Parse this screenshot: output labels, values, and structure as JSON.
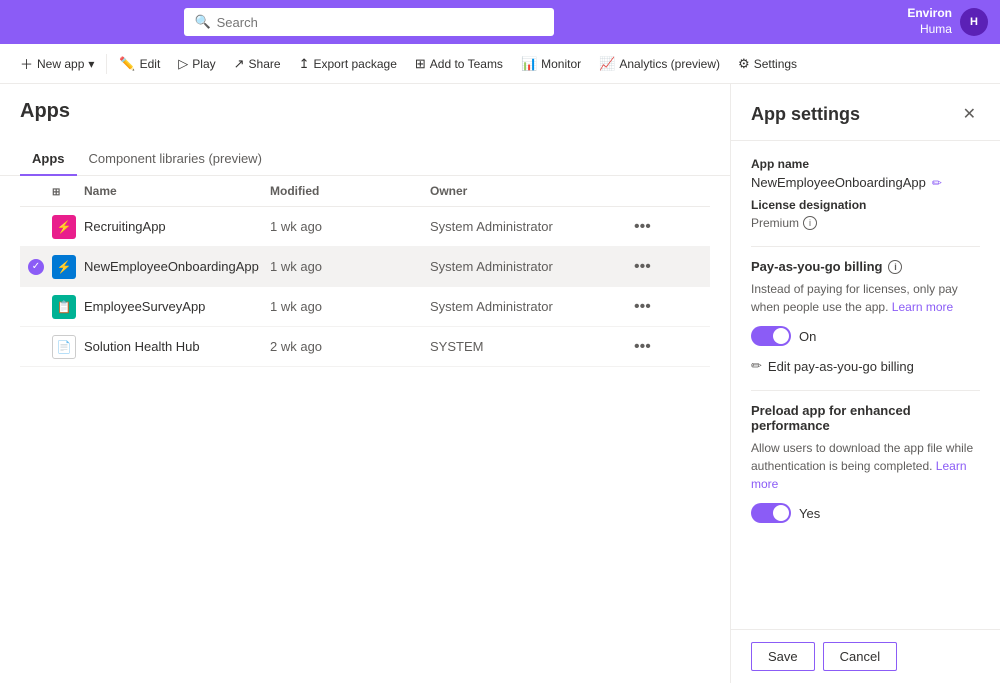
{
  "topbar": {
    "search_placeholder": "Search",
    "env_name": "Environ",
    "user_name": "Huma",
    "avatar_initials": "H"
  },
  "toolbar": {
    "new_app": "New app",
    "edit": "Edit",
    "play": "Play",
    "share": "Share",
    "export_package": "Export package",
    "add_to_teams": "Add to Teams",
    "monitor": "Monitor",
    "analytics": "Analytics (preview)",
    "settings": "Settings"
  },
  "page": {
    "title": "Apps",
    "tabs": [
      {
        "label": "Apps",
        "active": true
      },
      {
        "label": "Component libraries (preview)",
        "active": false
      }
    ]
  },
  "table": {
    "headers": [
      "",
      "",
      "Name",
      "Modified",
      "Owner",
      ""
    ],
    "rows": [
      {
        "id": 1,
        "name": "RecruitingApp",
        "modified": "1 wk ago",
        "owner": "System Administrator",
        "icon_type": "pink",
        "selected": false
      },
      {
        "id": 2,
        "name": "NewEmployeeOnboardingApp",
        "modified": "1 wk ago",
        "owner": "System Administrator",
        "icon_type": "blue",
        "selected": true
      },
      {
        "id": 3,
        "name": "EmployeeSurveyApp",
        "modified": "1 wk ago",
        "owner": "System Administrator",
        "icon_type": "teal",
        "selected": false
      },
      {
        "id": 4,
        "name": "Solution Health Hub",
        "modified": "2 wk ago",
        "owner": "SYSTEM",
        "icon_type": "doc",
        "selected": false
      }
    ]
  },
  "side_panel": {
    "title": "App settings",
    "app_name_label": "App name",
    "app_name_value": "NewEmployeeOnboardingApp",
    "license_label": "License designation",
    "license_value": "Premium",
    "payg_label": "Pay-as-you-go billing",
    "payg_desc": "Instead of paying for licenses, only pay when people use the app.",
    "payg_learn_more": "Learn more",
    "payg_toggle_label": "On",
    "edit_billing_label": "Edit pay-as-you-go billing",
    "preload_label": "Preload app for enhanced performance",
    "preload_desc": "Allow users to download the app file while authentication is being completed.",
    "preload_learn_more": "Learn more",
    "preload_toggle_label": "Yes",
    "save_label": "Save",
    "cancel_label": "Cancel"
  }
}
